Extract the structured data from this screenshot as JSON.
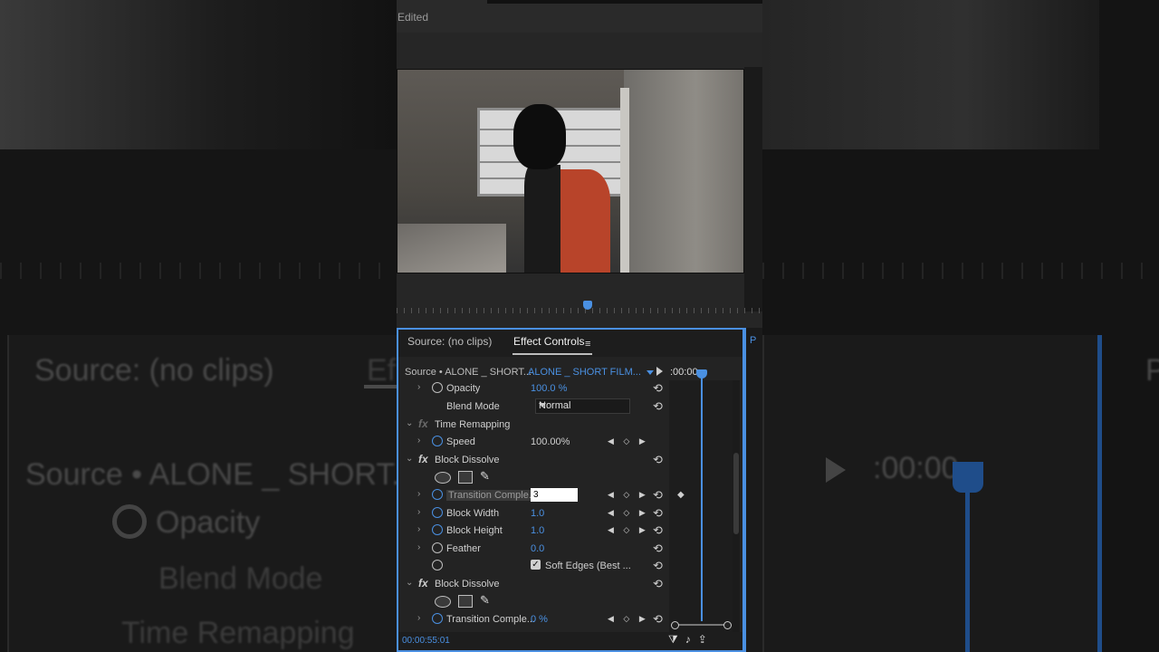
{
  "window": {
    "title_fragment": "Edited"
  },
  "background_ghost": {
    "source_tab": "Source: (no clips)",
    "effect_tab_fragment": "Ef",
    "clip_source": "Source • ALONE _ SHORT...",
    "opacity": "Opacity",
    "blend_mode": "Blend Mode",
    "time_remapping": "Time Remapping",
    "timecode": ":00:00",
    "right_fragment": "P"
  },
  "panel": {
    "tabs": {
      "source": "Source: (no clips)",
      "effect_controls": "Effect Controls",
      "menu": "≡"
    },
    "header": {
      "source_clip": "Source • ALONE _ SHORT...",
      "sequence_clip": "ALONE _ SHORT FILM...",
      "timecode": ":00:00"
    },
    "right_label": "P",
    "rows": {
      "opacity": {
        "name": "Opacity",
        "value": "100.0 %"
      },
      "blend_mode": {
        "name": "Blend Mode",
        "value": "Normal"
      },
      "time_remapping": {
        "name": "Time Remapping"
      },
      "speed": {
        "name": "Speed",
        "value": "100.00%"
      },
      "block_dissolve_1": {
        "name": "Block Dissolve"
      },
      "transition_completion": {
        "name": "Transition Comple...",
        "value": "3"
      },
      "block_width": {
        "name": "Block Width",
        "value": "1.0"
      },
      "block_height": {
        "name": "Block Height",
        "value": "1.0"
      },
      "feather": {
        "name": "Feather",
        "value": "0.0"
      },
      "soft_edges": {
        "name": "Soft Edges (Best ...",
        "checked": true
      },
      "block_dissolve_2": {
        "name": "Block Dissolve"
      },
      "transition_completion_2": {
        "name": "Transition Comple...",
        "value": "0 %"
      }
    },
    "footer": {
      "timecode": "00:00:55:01"
    }
  },
  "icons": {
    "fx": "fx",
    "reset": "⟲",
    "nav": "◀ ◇ ▶",
    "pen": "✎",
    "check": "✓",
    "play": "▶",
    "filter": "⧩",
    "audio": "♪",
    "export": "⇪"
  }
}
